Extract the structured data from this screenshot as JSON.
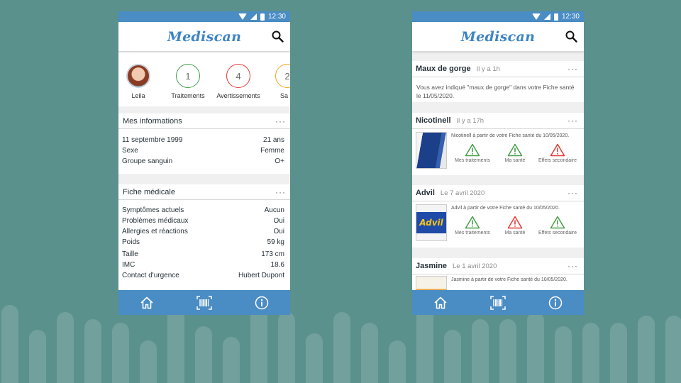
{
  "status": {
    "time": "12:30"
  },
  "app": {
    "name": "Mediscan"
  },
  "profile": {
    "items": [
      {
        "label": "Leila",
        "kind": "avatar"
      },
      {
        "label": "Traitements",
        "value": "1",
        "color": "#43a047"
      },
      {
        "label": "Avertissements",
        "value": "4",
        "color": "#e53935"
      },
      {
        "label": "Sa",
        "value": "2",
        "color": "#f5a623"
      }
    ]
  },
  "mes_informations": {
    "title": "Mes informations",
    "rows": [
      {
        "label": "11 septembre 1999",
        "value": "21 ans"
      },
      {
        "label": "Sexe",
        "value": "Femme"
      },
      {
        "label": "Groupe sanguin",
        "value": "O+"
      }
    ]
  },
  "fiche_medicale": {
    "title": "Fiche médicale",
    "rows": [
      {
        "label": "Symptômes actuels",
        "value": "Aucun"
      },
      {
        "label": "Problèmes médicaux",
        "value": "Oui"
      },
      {
        "label": "Allergies et réactions",
        "value": "Oui"
      },
      {
        "label": "Poids",
        "value": "59 kg"
      },
      {
        "label": "Taille",
        "value": "173 cm"
      },
      {
        "label": "IMC",
        "value": "18.6"
      },
      {
        "label": "Contact d'urgence",
        "value": "Hubert Dupont"
      }
    ]
  },
  "feed": [
    {
      "title": "Maux de gorge",
      "time": "Il y a 1h",
      "text": "Vous avez indiqué \"maux de gorge\" dans votre Fiche santé le 11/05/2020."
    },
    {
      "title": "Nicotinell",
      "time": "Il y a 17h",
      "desc": "Nicotinell à partir de votre Fiche santé du 10/05/2020.",
      "actions": [
        {
          "label": "Mes traitements",
          "color": "#43a047"
        },
        {
          "label": "Ma santé",
          "color": "#43a047"
        },
        {
          "label": "Effets secondaire",
          "color": "#e53935"
        }
      ]
    },
    {
      "title": "Advil",
      "time": "Le 7 avril 2020",
      "desc": "Advil à partir de votre Fiche santé du 10/05/2020.",
      "image_text": "Advil",
      "actions": [
        {
          "label": "Mes traitements",
          "color": "#43a047"
        },
        {
          "label": "Ma santé",
          "color": "#e53935"
        },
        {
          "label": "Effets secondaire",
          "color": "#43a047"
        }
      ]
    },
    {
      "title": "Jasmine",
      "time": "Le 1 avril 2020",
      "desc": "Jasmine à partir de votre Fiche santé du 10/05/2020."
    }
  ],
  "nav": {
    "icons": [
      "home-icon",
      "barcode-scan-icon",
      "info-icon"
    ]
  },
  "colors": {
    "primary": "#4a8cc4",
    "background": "#5b918c",
    "ok": "#43a047",
    "warning": "#e53935"
  }
}
